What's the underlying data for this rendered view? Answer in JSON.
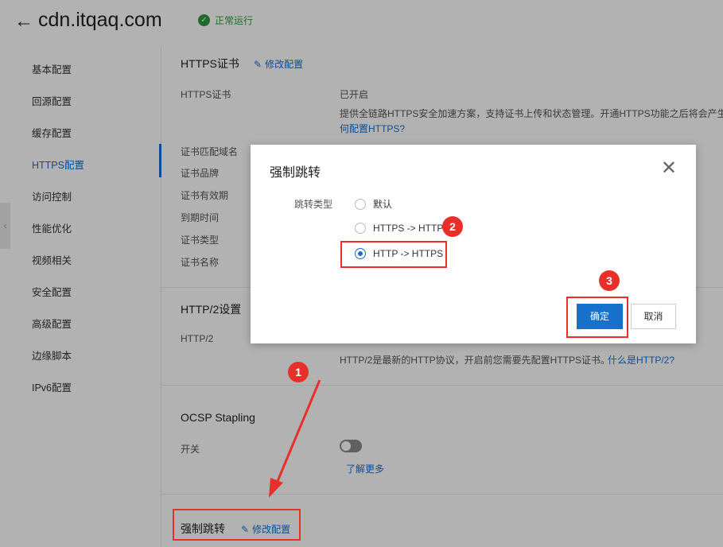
{
  "header": {
    "back_icon": "arrow-left-icon",
    "domain": "cdn.itqaq.com",
    "status_icon": "check-circle-icon",
    "status": "正常运行",
    "status_color": "#2e9a3c"
  },
  "sidebar": {
    "items": [
      {
        "label": "基本配置"
      },
      {
        "label": "回源配置"
      },
      {
        "label": "缓存配置"
      },
      {
        "label": "HTTPS配置",
        "active": true
      },
      {
        "label": "访问控制"
      },
      {
        "label": "性能优化"
      },
      {
        "label": "视频相关"
      },
      {
        "label": "安全配置"
      },
      {
        "label": "高级配置"
      },
      {
        "label": "边缘脚本"
      },
      {
        "label": "IPv6配置"
      }
    ],
    "collapse_icon": "chevron-left-icon"
  },
  "https_cert": {
    "title": "HTTPS证书",
    "edit_label": "修改配置",
    "cert_label": "HTTPS证书",
    "cert_value": "已开启",
    "desc": "提供全链路HTTPS安全加速方案，支持证书上传和状态管理。开通HTTPS功能之后将会产生H",
    "help_link": "何配置HTTPS?",
    "fields": [
      "证书匹配域名",
      "证书品牌",
      "证书有效期",
      "到期时间",
      "证书类型",
      "证书名称"
    ]
  },
  "http2": {
    "title": "HTTP/2设置",
    "label": "HTTP/2",
    "desc": "HTTP/2是最新的HTTP协议，开启前您需要先配置HTTPS证书。",
    "help_link": "什么是HTTP/2?"
  },
  "ocsp": {
    "title": "OCSP Stapling",
    "switch_label": "开关",
    "enabled": false,
    "learn_more": "了解更多"
  },
  "force_redirect": {
    "title": "强制跳转",
    "edit_label": "修改配置"
  },
  "dialog": {
    "title": "强制跳转",
    "close_icon": "close-icon",
    "field_label": "跳转类型",
    "options": [
      {
        "label": "默认",
        "checked": false
      },
      {
        "label": "HTTPS -> HTTP",
        "checked": false
      },
      {
        "label": "HTTP -> HTTPS",
        "checked": true
      }
    ],
    "ok_label": "确定",
    "cancel_label": "取消"
  },
  "annotations": {
    "color": "#e8302a",
    "badges": [
      "1",
      "2",
      "3"
    ]
  },
  "accent_color": "#1670cc"
}
